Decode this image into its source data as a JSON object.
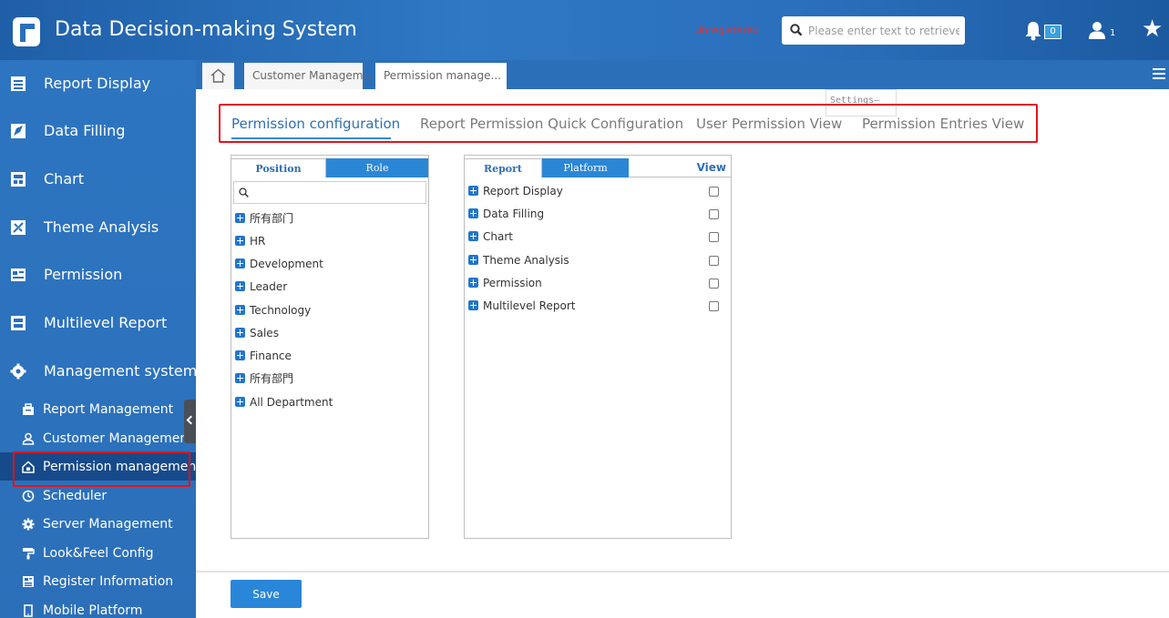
{
  "header": {
    "title": "Data Decision-making System",
    "unregistered": "Unregistered",
    "search_placeholder": "Please enter text to retrieve",
    "notifications_count": "0",
    "users_count": "1"
  },
  "sidebar": {
    "items": [
      {
        "label": "Report Display",
        "icon": "report-display-icon"
      },
      {
        "label": "Data Filling",
        "icon": "data-filling-icon"
      },
      {
        "label": "Chart",
        "icon": "chart-icon"
      },
      {
        "label": "Theme Analysis",
        "icon": "theme-analysis-icon"
      },
      {
        "label": "Permission",
        "icon": "permission-icon"
      },
      {
        "label": "Multilevel Report",
        "icon": "multilevel-report-icon"
      },
      {
        "label": "Management system",
        "icon": "gear-icon"
      }
    ],
    "sub_items": [
      {
        "label": "Report Management",
        "icon": "briefcase-icon"
      },
      {
        "label": "Customer Management",
        "icon": "user-icon"
      },
      {
        "label": "Permission management",
        "icon": "lock-icon",
        "active": true
      },
      {
        "label": "Scheduler",
        "icon": "clock-icon"
      },
      {
        "label": "Server Management",
        "icon": "gear-icon"
      },
      {
        "label": "Look&Feel Config",
        "icon": "paint-roller-icon"
      },
      {
        "label": "Register Information",
        "icon": "register-icon"
      },
      {
        "label": "Mobile Platform",
        "icon": "mobile-icon"
      }
    ]
  },
  "page_tabs": {
    "tab1": "Customer Managem...",
    "tab2": "Permission manage..."
  },
  "settings_tip": "Settings—",
  "top_tabs": [
    {
      "label": "Permission configuration",
      "active": true
    },
    {
      "label": "Report Permission Quick Configuration"
    },
    {
      "label": "User Permission View"
    },
    {
      "label": "Permission Entries View"
    }
  ],
  "left_panel": {
    "tab_position": "Position",
    "tab_role": "Role",
    "items": [
      "所有部门",
      "HR",
      "Development",
      "Leader",
      "Technology",
      "Sales",
      "Finance",
      "所有部門",
      "All Department"
    ]
  },
  "right_panel": {
    "tab_report": "Report",
    "tab_platform": "Platform",
    "view_label": "View",
    "items": [
      "Report Display",
      "Data Filling",
      "Chart",
      "Theme Analysis",
      "Permission",
      "Multilevel Report"
    ]
  },
  "save_label": "Save",
  "colors": {
    "header": "#2a6fbb",
    "sidebar": "#2c6fb9",
    "accent": "#2a86d8",
    "highlight": "#e3141c"
  }
}
